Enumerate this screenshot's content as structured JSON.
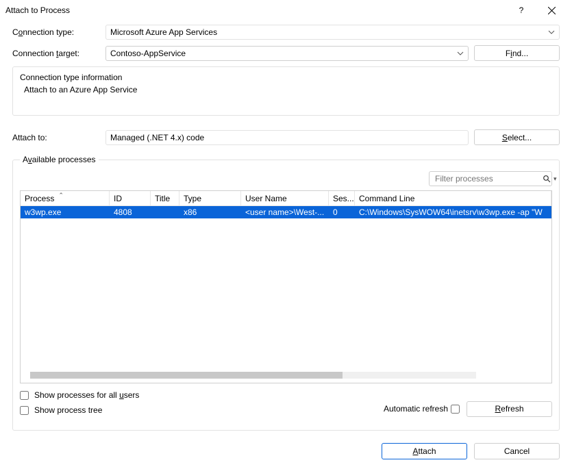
{
  "window": {
    "title": "Attach to Process"
  },
  "labels": {
    "connection_type_pre": "C",
    "connection_type_u": "o",
    "connection_type_post": "nnection type:",
    "connection_target_pre": "Connection ",
    "connection_target_u": "t",
    "connection_target_post": "arget:",
    "attach_to": "Attach to:",
    "available_pre": "A",
    "available_u": "v",
    "available_post": "ailable processes"
  },
  "connection_type": {
    "value": "Microsoft Azure App Services"
  },
  "connection_target": {
    "value": "Contoso-AppService"
  },
  "find_button": {
    "pre": "F",
    "u": "i",
    "post": "nd..."
  },
  "info": {
    "title": "Connection type information",
    "line": "Attach to an Azure App Service"
  },
  "attach_to": {
    "value": "Managed (.NET 4.x) code"
  },
  "select_button": {
    "pre": "",
    "u": "S",
    "post": "elect..."
  },
  "filter": {
    "placeholder": "Filter processes"
  },
  "columns": {
    "process": "Process",
    "id": "ID",
    "title": "Title",
    "type": "Type",
    "user": "User Name",
    "session": "Ses...",
    "cmd": "Command Line"
  },
  "rows": [
    {
      "process": "w3wp.exe",
      "id": "4808",
      "title": "",
      "type": "x86",
      "user": "<user name>\\West-...",
      "session": "0",
      "cmd": "C:\\Windows\\SysWOW64\\inetsrv\\w3wp.exe -ap \"W"
    }
  ],
  "checkboxes": {
    "show_all_pre": "Show processes for all ",
    "show_all_u": "u",
    "show_all_post": "sers",
    "show_tree": "Show process tree"
  },
  "auto_refresh_label": "Automatic refresh",
  "refresh_button": {
    "pre": "",
    "u": "R",
    "post": "efresh"
  },
  "footer": {
    "attach_pre": "",
    "attach_u": "A",
    "attach_post": "ttach",
    "cancel": "Cancel"
  }
}
